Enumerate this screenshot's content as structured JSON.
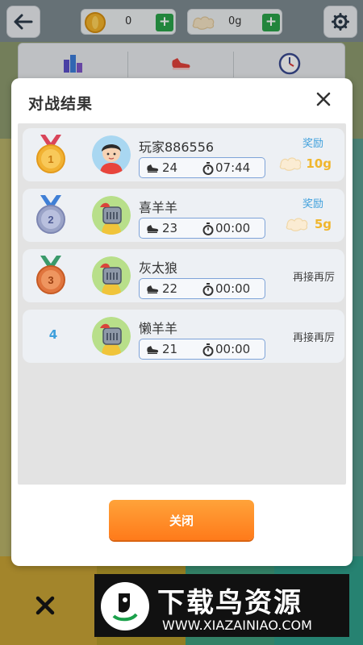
{
  "topbar": {
    "coins": "0",
    "food": "0g"
  },
  "modal": {
    "title": "对战结果",
    "close_label": "关闭"
  },
  "results": [
    {
      "rank": "1",
      "name": "玩家886556",
      "steps": "24",
      "time": "07:44",
      "reward_label": "奖励",
      "reward": "10g",
      "avatar": "player-avatar"
    },
    {
      "rank": "2",
      "name": "喜羊羊",
      "steps": "23",
      "time": "00:00",
      "reward_label": "奖励",
      "reward": "5g",
      "avatar": "knight-avatar"
    },
    {
      "rank": "3",
      "name": "灰太狼",
      "steps": "22",
      "time": "00:00",
      "note": "再接再厉",
      "avatar": "knight-avatar"
    },
    {
      "rank": "4",
      "name": "懒羊羊",
      "steps": "21",
      "time": "00:00",
      "note": "再接再厉",
      "avatar": "knight-avatar"
    }
  ],
  "watermark": {
    "title": "下载鸟资源",
    "url": "WWW.XIAZAINIAO.COM"
  },
  "colors": {
    "accent_blue": "#3fa0dc",
    "reward_gold": "#f0b62c",
    "close_orange": "#ff8a25",
    "plus_green": "#2aa34a"
  }
}
